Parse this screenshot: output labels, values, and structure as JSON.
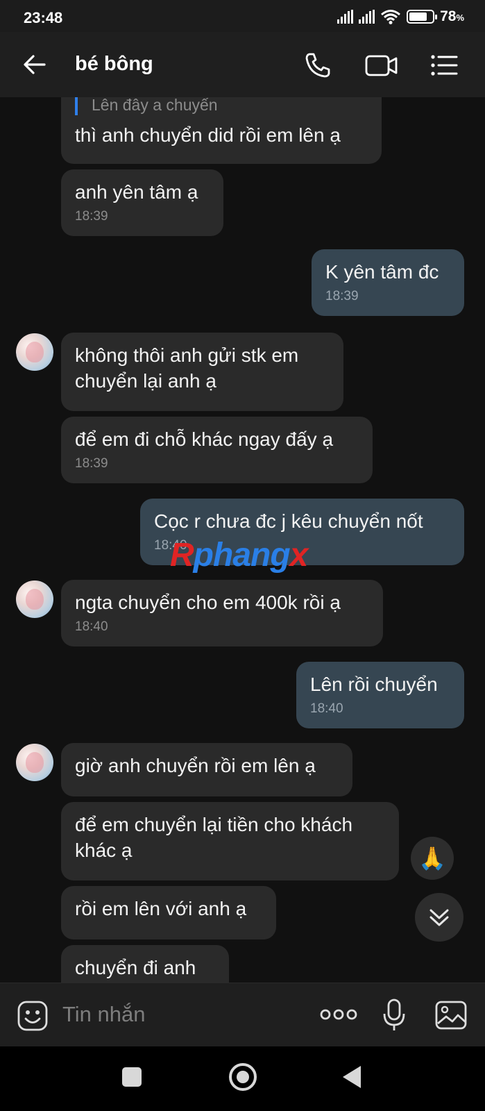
{
  "status": {
    "time": "23:48",
    "battery_pct": "78",
    "battery_unit": "%",
    "battery_level": 0.78
  },
  "header": {
    "contact_name": "bé bông"
  },
  "messages": [
    {
      "quote": "Lên đây a chuyến",
      "text": "thì anh chuyển did rồi em lên ạ"
    },
    {
      "text": "anh yên tâm ạ",
      "time": "18:39"
    },
    {
      "text": "K yên tâm đc",
      "time": "18:39"
    },
    {
      "text_lines": [
        "không thôi anh gửi stk em",
        "chuyển lại anh ạ"
      ]
    },
    {
      "text": "để em đi chỗ khác ngay đấy ạ",
      "time": "18:39"
    },
    {
      "text": "Cọc r chưa đc j kêu chuyển nốt",
      "time": "18:40"
    },
    {
      "text": "ngta chuyển cho em 400k rồi ạ",
      "time": "18:40"
    },
    {
      "text": "Lên rồi chuyển",
      "time": "18:40"
    },
    {
      "text": "giờ anh chuyển rồi em lên ạ"
    },
    {
      "text_lines": [
        "để em chuyển lại tiền cho khách",
        "khác ạ"
      ]
    },
    {
      "text": "rồi em lên với anh ạ"
    },
    {
      "text": "chuyển đi anh"
    }
  ],
  "reaction": {
    "emoji": "🙏"
  },
  "watermark": {
    "part1": "R",
    "part2": "phang",
    "part3": "x"
  },
  "composer": {
    "placeholder": "Tin nhắn"
  },
  "icons": {
    "back": "arrow-left-icon",
    "call": "phone-icon",
    "video": "video-camera-icon",
    "menu": "list-icon",
    "emoji": "smiley-icon",
    "more": "three-dots-icon",
    "mic": "microphone-icon",
    "image": "image-icon",
    "scroll": "chevrons-down-icon"
  },
  "colors": {
    "incoming_bubble": "#2a2a2a",
    "outgoing_bubble": "#364652",
    "quote_bar": "#2f7fea"
  }
}
